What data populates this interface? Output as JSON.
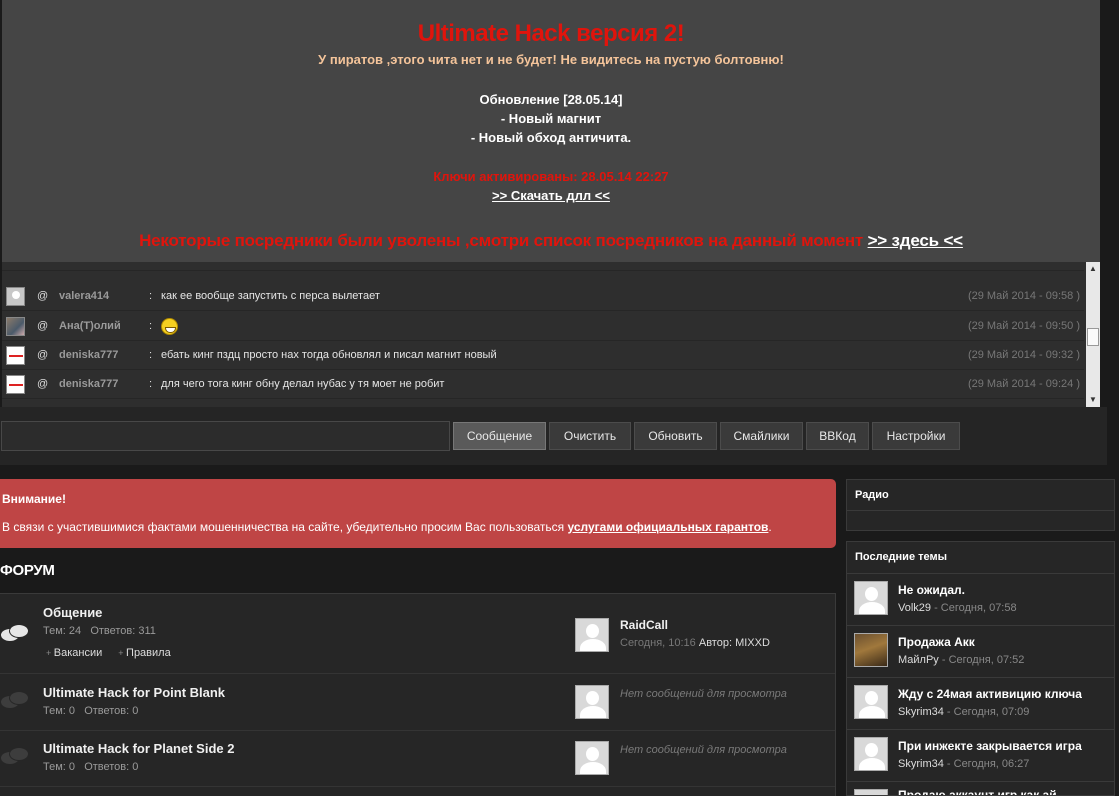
{
  "banner": {
    "title": "Ultimate Hack версия 2!",
    "warning": "У пиратов ,этого чита нет и не будет! Не видитесь на пустую болтовню!",
    "update_title": "Обновление [28.05.14]",
    "update_items": [
      "- Новый магнит",
      "- Новый обход античита."
    ],
    "keys": "Ключи активированы: 28.05.14 22:27",
    "download": ">> Скачать длл <<",
    "middlemen_text": "Некоторые посредники были уволены ,смотри список посредников на данный момент",
    "middlemen_link": ">> здесь <<"
  },
  "chat": {
    "messages": [
      {
        "nick": "valera414",
        "text": "как ее вообще запустить с перса вылетает",
        "time": "(29 Май 2014 - 09:58 )"
      },
      {
        "nick": "Ана(Т)олий",
        "text": "",
        "emoji": "smile-emoji",
        "time": "(29 Май 2014 - 09:50 )"
      },
      {
        "nick": "deniska777",
        "text": "ебать кинг пздц просто нах тогда обновлял и писал магнит новый",
        "time": "(29 Май 2014 - 09:32 )"
      },
      {
        "nick": "deniska777",
        "text": "для чего тога кинг обну делал нубас у тя моет не робит",
        "time": "(29 Май 2014 - 09:24 )"
      }
    ],
    "at_symbol": "@",
    "separator": ":",
    "input_value": "",
    "buttons": [
      "Сообщение",
      "Очистить",
      "Обновить",
      "Смайлики",
      "BBКод",
      "Настройки"
    ]
  },
  "alert": {
    "heading": "Внимание!",
    "text_before": "В связи с участившимися фактами мошенничества на сайте, убедительно просим Вас пользоваться ",
    "link": "услугами официальных гарантов",
    "text_after": "."
  },
  "forum": {
    "heading": "ФОРУМ",
    "topics_label": "Тем:",
    "replies_label": "Ответов:",
    "rows": [
      {
        "title": "Общение",
        "topics": "24",
        "replies": "311",
        "subforums": [
          "Вакансии",
          "Правила"
        ],
        "last_title": "RaidCall",
        "last_time": "Сегодня, 10:16",
        "last_author_label": "Автор:",
        "last_author": "MIXXD"
      },
      {
        "title": "Ultimate Hack for Point Blank",
        "topics": "0",
        "replies": "0",
        "no_posts": "Нет сообщений для просмотра"
      },
      {
        "title": "Ultimate Hack for Planet Side 2",
        "topics": "0",
        "replies": "0",
        "no_posts": "Нет сообщений для просмотра"
      }
    ]
  },
  "sidebar": {
    "radio_title": "Радио",
    "recent_title": "Последние темы",
    "topics": [
      {
        "title": "Не ожидал.",
        "user": "Volk29",
        "time": " - Сегодня, 07:58"
      },
      {
        "title": "Продажа Акк",
        "user": "МайлРу",
        "time": " - Сегодня, 07:52"
      },
      {
        "title": "Жду с 24мая активицию ключа",
        "user": "Skyrim34",
        "time": " - Сегодня, 07:09"
      },
      {
        "title": "При инжекте закрывается игра",
        "user": "Skyrim34",
        "time": " - Сегодня, 06:27"
      },
      {
        "title": "Продаю аккаунт игр как ай",
        "user": "",
        "time": ""
      }
    ]
  }
}
